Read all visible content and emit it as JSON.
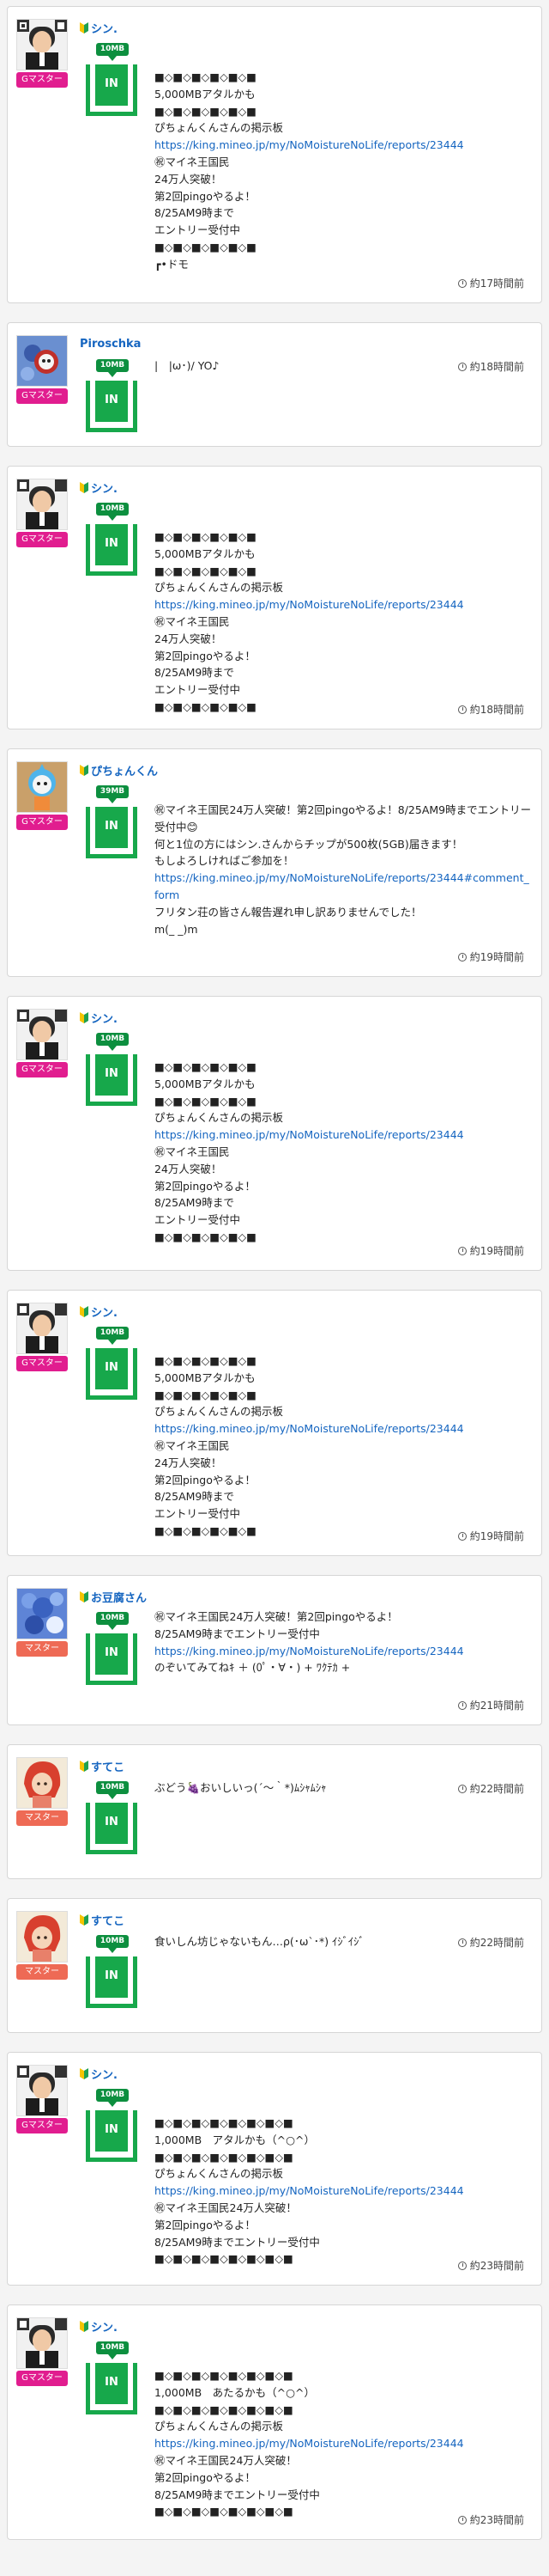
{
  "badges": {
    "g_master": "Gマスター",
    "master": "マスター"
  },
  "gift_tags": {
    "c1": "10MB",
    "c2": "10MB",
    "c3": "10MB",
    "c4": "39MB",
    "c5": "10MB",
    "c6": "10MB",
    "c7": "10MB",
    "c8": "10MB",
    "c9": "10MB",
    "c10": "10MB",
    "c11": "10MB"
  },
  "gift_in": "IN",
  "cards": [
    {
      "name": "シン.",
      "time": "約17時間前",
      "lines": [
        "■◇■◇■◇■◇■◇■",
        "5,000MBアタルかも",
        "■◇■◇■◇■◇■◇■",
        "ぴちょんくんさんの掲示板",
        "https://king.mineo.jp/my/NoMoistureNoLife/reports/23444",
        "㊗マイネ王国民",
        "24万人突破！",
        "第2回pingoやるよ！",
        "8/25AM9時まで",
        "エントリー受付中",
        "■◇■◇■◇■◇■◇■",
        "┏•ドモ"
      ]
    },
    {
      "name": "Piroschka",
      "time": "約18時間前",
      "lines": [
        "|　|ω･)/ YO♪"
      ]
    },
    {
      "name": "シン.",
      "time": "約18時間前",
      "lines": [
        "■◇■◇■◇■◇■◇■",
        "5,000MBアタルかも",
        "■◇■◇■◇■◇■◇■",
        "ぴちょんくんさんの掲示板",
        "https://king.mineo.jp/my/NoMoistureNoLife/reports/23444",
        "㊗マイネ王国民",
        "24万人突破！",
        "第2回pingoやるよ！",
        "8/25AM9時まで",
        "エントリー受付中",
        "■◇■◇■◇■◇■◇■"
      ]
    },
    {
      "name": "ぴちょんくん",
      "time": "約19時間前",
      "lines": [
        "㊗マイネ王国民24万人突破！第2回pingoやるよ！8/25AM9時までエントリー受付中😊",
        "何と1位の方にはシン.さんからチップが500枚(5GB)届きます！",
        "もしよろしければご参加を！",
        "https://king.mineo.jp/my/NoMoistureNoLife/reports/23444#comment_form",
        "フリタン荘の皆さん報告遅れ申し訳ありませんでした！",
        "m(_ _)m"
      ]
    },
    {
      "name": "シン.",
      "time": "約19時間前",
      "lines": [
        "■◇■◇■◇■◇■◇■",
        "5,000MBアタルかも",
        "■◇■◇■◇■◇■◇■",
        "ぴちょんくんさんの掲示板",
        "https://king.mineo.jp/my/NoMoistureNoLife/reports/23444",
        "㊗マイネ王国民",
        "24万人突破！",
        "第2回pingoやるよ！",
        "8/25AM9時まで",
        "エントリー受付中",
        "■◇■◇■◇■◇■◇■"
      ]
    },
    {
      "name": "シン.",
      "time": "約19時間前",
      "lines": [
        "■◇■◇■◇■◇■◇■",
        "5,000MBアタルかも",
        "■◇■◇■◇■◇■◇■",
        "ぴちょんくんさんの掲示板",
        "https://king.mineo.jp/my/NoMoistureNoLife/reports/23444",
        "㊗マイネ王国民",
        "24万人突破！",
        "第2回pingoやるよ！",
        "8/25AM9時まで",
        "エントリー受付中",
        "■◇■◇■◇■◇■◇■"
      ]
    },
    {
      "name": "お豆腐さん",
      "time": "約21時間前",
      "lines": [
        "㊗マイネ王国民24万人突破！第2回pingoやるよ！",
        "8/25AM9時までエントリー受付中",
        "https://king.mineo.jp/my/NoMoistureNoLife/reports/23444",
        "のぞいてみてねｷ ＋ (0ﾟ・∀・) + ﾜｸﾃｶ +"
      ]
    },
    {
      "name": "すてこ",
      "time": "約22時間前",
      "lines": [
        "ぶどう🍇おいしいっ(´～｀*)ﾑｼｬﾑｼｬ"
      ]
    },
    {
      "name": "すてこ",
      "time": "約22時間前",
      "lines": [
        "食いしん坊じゃないもん…ρ(･ω`･*) ｲｼﾞｲｼﾞ"
      ]
    },
    {
      "name": "シン.",
      "time": "約23時間前",
      "lines": [
        "■◇■◇■◇■◇■◇■◇■◇■",
        "1,000MB　アタルかも（^○^）",
        "■◇■◇■◇■◇■◇■◇■◇■",
        "ぴちょんくんさんの掲示板",
        "https://king.mineo.jp/my/NoMoistureNoLife/reports/23444",
        "㊗マイネ王国民24万人突破！",
        "第2回pingoやるよ！",
        "8/25AM9時までエントリー受付中",
        "■◇■◇■◇■◇■◇■◇■◇■"
      ]
    },
    {
      "name": "シン.",
      "time": "約23時間前",
      "lines": [
        "■◇■◇■◇■◇■◇■◇■◇■",
        "1,000MB　あたるかも（^○^）",
        "■◇■◇■◇■◇■◇■◇■◇■",
        "ぴちょんくんさんの掲示板",
        "https://king.mineo.jp/my/NoMoistureNoLife/reports/23444",
        "㊗マイネ王国民24万人突破！",
        "第2回pingoやるよ！",
        "8/25AM9時までエントリー受付中",
        "■◇■◇■◇■◇■◇■◇■◇■"
      ]
    }
  ]
}
